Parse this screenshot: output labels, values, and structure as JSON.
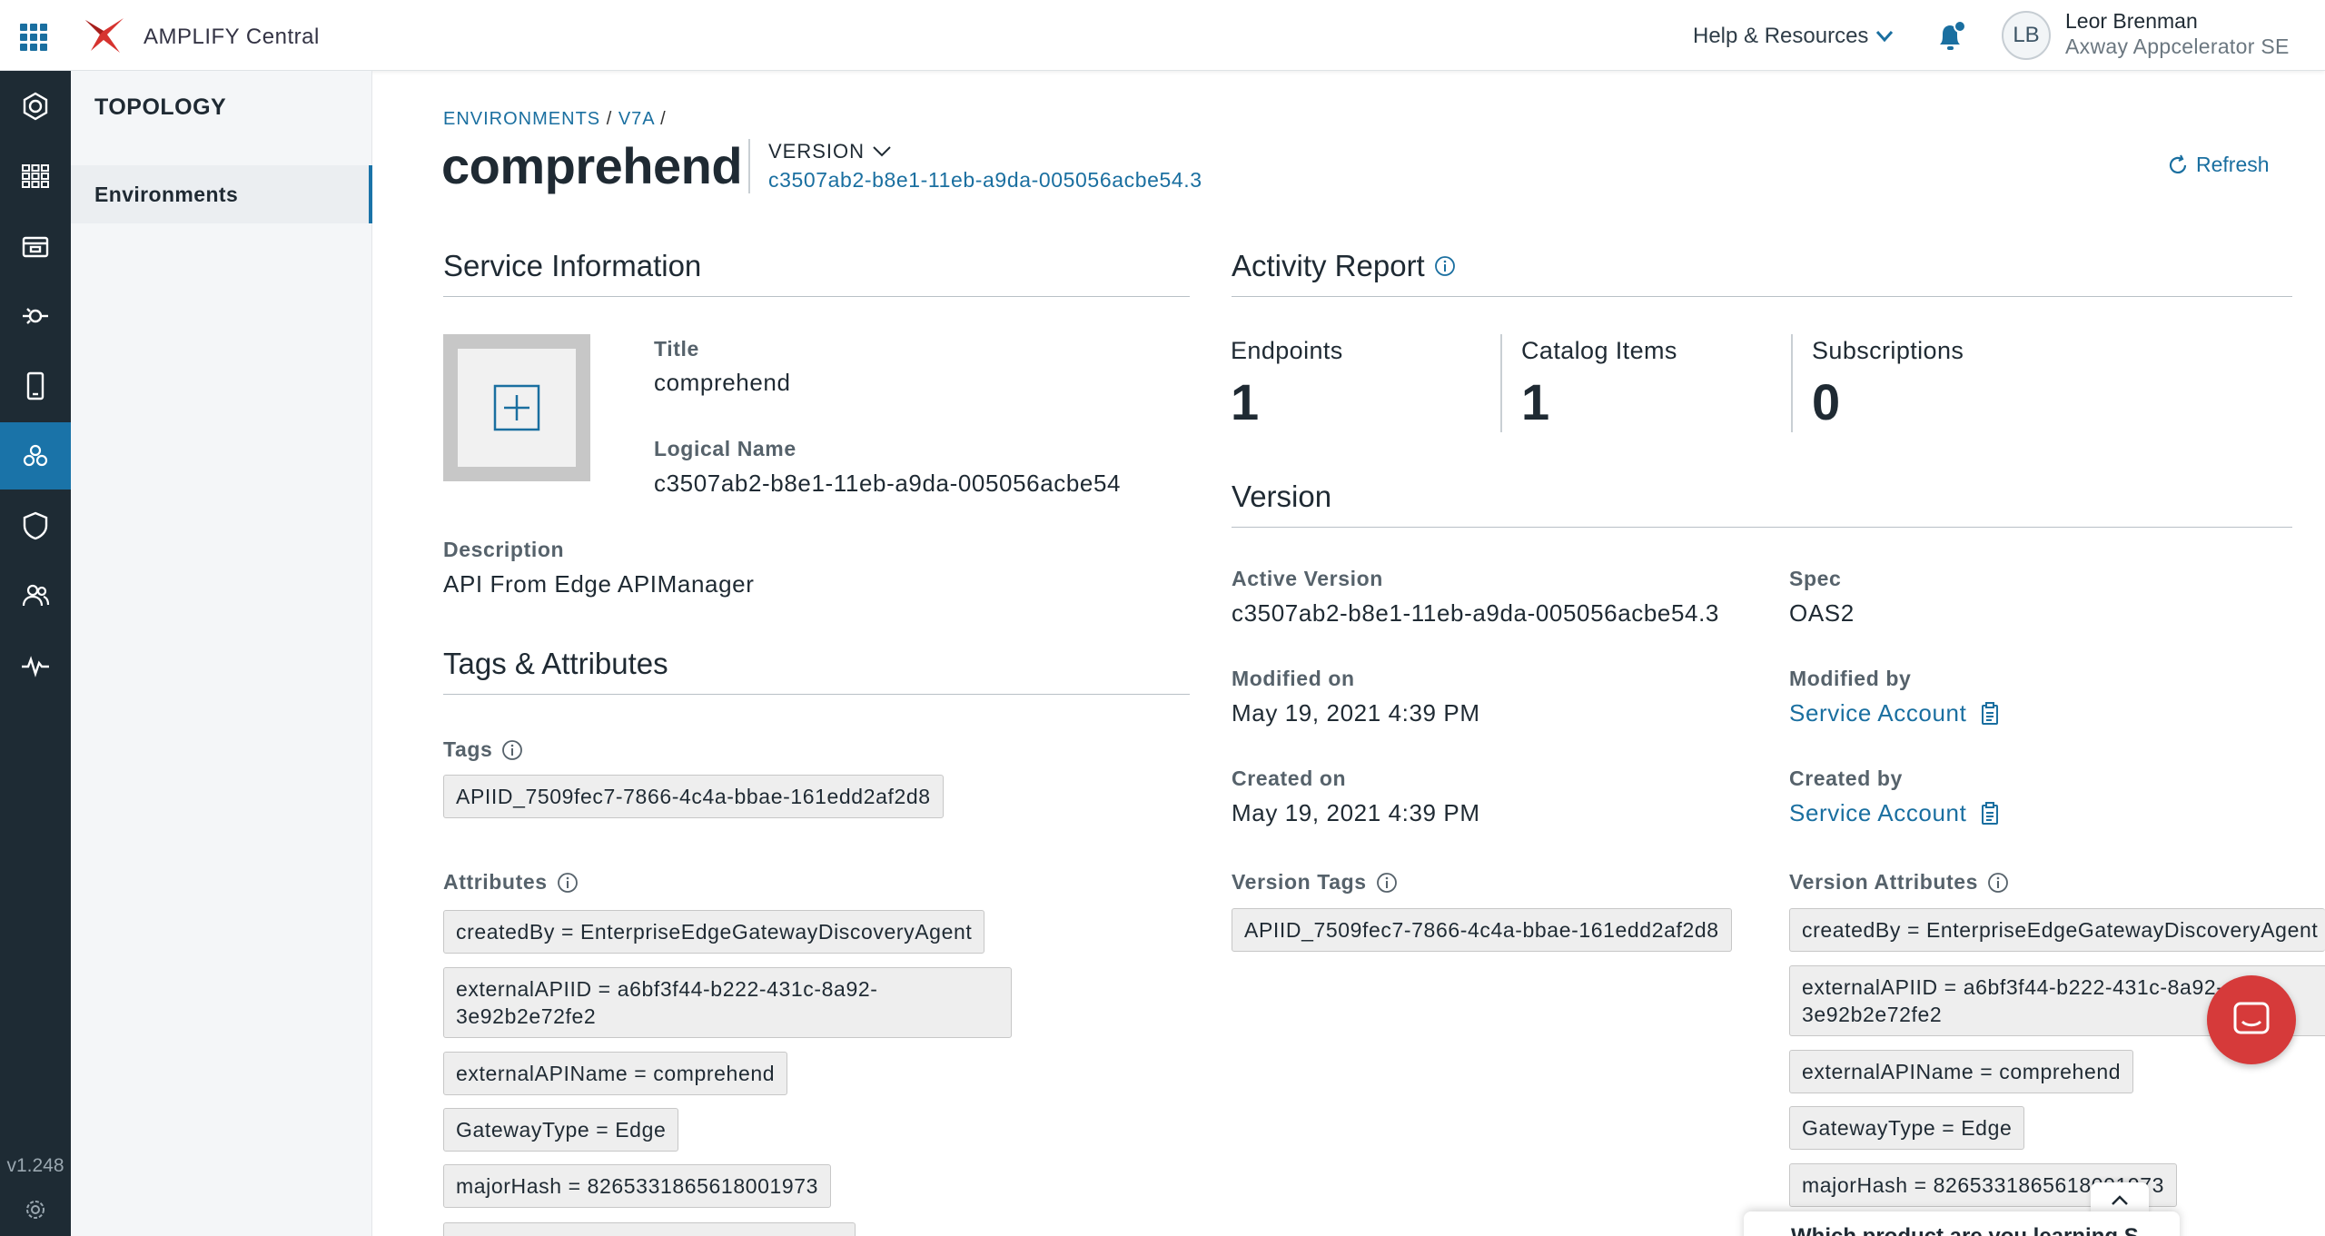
{
  "topbar": {
    "product_name": "AMPLIFY Central",
    "help_label": "Help & Resources",
    "user": {
      "initials": "LB",
      "name": "Leor Brenman",
      "org": "Axway Appcelerator SE"
    }
  },
  "rail": {
    "items": [
      "dashboard-icon",
      "catalog-icon",
      "marketplace-icon",
      "integrations-icon",
      "mobile-icon",
      "topology-icon",
      "security-icon",
      "users-icon",
      "observability-icon"
    ],
    "active": "topology-icon",
    "version": "v1.248"
  },
  "sidenav": {
    "title": "TOPOLOGY",
    "items": [
      {
        "label": "Environments",
        "active": true
      }
    ]
  },
  "header": {
    "breadcrumb": {
      "root": "ENVIRONMENTS",
      "env": "V7A",
      "sep": "/"
    },
    "title": "comprehend",
    "version_label": "VERSION",
    "version_id": "c3507ab2-b8e1-11eb-a9da-005056acbe54.3",
    "refresh_label": "Refresh"
  },
  "service_info": {
    "heading": "Service Information",
    "title_label": "Title",
    "title_value": "comprehend",
    "logical_name_label": "Logical Name",
    "logical_name_value": "c3507ab2-b8e1-11eb-a9da-005056acbe54",
    "description_label": "Description",
    "description_value": "API From Edge APIManager"
  },
  "tags_attributes": {
    "heading": "Tags & Attributes",
    "tags_label": "Tags",
    "tags": [
      "APIID_7509fec7-7866-4c4a-bbae-161edd2af2d8"
    ],
    "attributes_label": "Attributes",
    "attributes": [
      "createdBy = EnterpriseEdgeGatewayDiscoveryAgent",
      "externalAPIID = a6bf3f44-b222-431c-8a92-3e92b2e72fe2",
      "externalAPIName = comprehend",
      "GatewayType = Edge",
      "majorHash = 8265331865618001973"
    ]
  },
  "activity": {
    "heading": "Activity Report",
    "stats": [
      {
        "label": "Endpoints",
        "value": "1"
      },
      {
        "label": "Catalog Items",
        "value": "1"
      },
      {
        "label": "Subscriptions",
        "value": "0"
      }
    ]
  },
  "version": {
    "heading": "Version",
    "active_version_label": "Active Version",
    "active_version_value": "c3507ab2-b8e1-11eb-a9da-005056acbe54.3",
    "spec_label": "Spec",
    "spec_value": "OAS2",
    "modified_on_label": "Modified on",
    "modified_on_value": "May 19, 2021 4:39 PM",
    "modified_by_label": "Modified by",
    "modified_by_value": "Service Account",
    "created_on_label": "Created on",
    "created_on_value": "May 19, 2021 4:39 PM",
    "created_by_label": "Created by",
    "created_by_value": "Service Account",
    "tags_label": "Version Tags",
    "tags": [
      "APIID_7509fec7-7866-4c4a-bbae-161edd2af2d8"
    ],
    "attributes_label": "Version Attributes",
    "attributes": [
      "createdBy = EnterpriseEdgeGatewayDiscoveryAgent",
      "externalAPIID = a6bf3f44-b222-431c-8a92-3e92b2e72fe2",
      "externalAPIName = comprehend",
      "GatewayType = Edge",
      "majorHash = 8265331865618001973"
    ]
  },
  "help_popup": {
    "text": "Which product are you learning S..."
  },
  "colors": {
    "accent": "#1a73a8",
    "rail_bg": "#1e2b34",
    "chat": "#d63a3a",
    "link": "#1a6fa0"
  }
}
